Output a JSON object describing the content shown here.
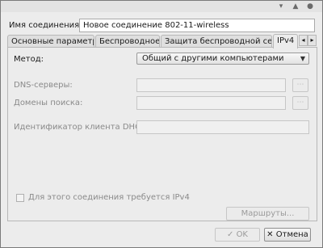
{
  "window": {
    "controls": [
      "minimize-icon",
      "maximize-icon",
      "close-icon"
    ]
  },
  "connection": {
    "name_label": "Имя соединения:",
    "name_value": "Новое соединение 802-11-wireless"
  },
  "tabs": [
    {
      "label": "Основные параметры"
    },
    {
      "label": "Беспроводное"
    },
    {
      "label": "Защита беспроводной сети"
    },
    {
      "label": "IPv4"
    }
  ],
  "tab_scroll": {
    "left": "◂",
    "right": "▸"
  },
  "ipv4": {
    "method_label": "Метод:",
    "method_value": "Общий с другими компьютерами",
    "dns_label": "DNS-серверы:",
    "dns_value": "",
    "search_label": "Домены поиска:",
    "search_value": "",
    "dhcp_label": "Идентификатор клиента DHCP:",
    "dhcp_value": "",
    "require_label": "Для этого соединения требуется IPv4",
    "require_checked": false,
    "routes_label": "Маршруты..."
  },
  "buttons": {
    "ok_label": "OK",
    "cancel_label": "Отмена"
  },
  "colors": {
    "window_bg": "#ececec",
    "border": "#b7b7b7",
    "disabled_text": "#9b9b9b"
  }
}
